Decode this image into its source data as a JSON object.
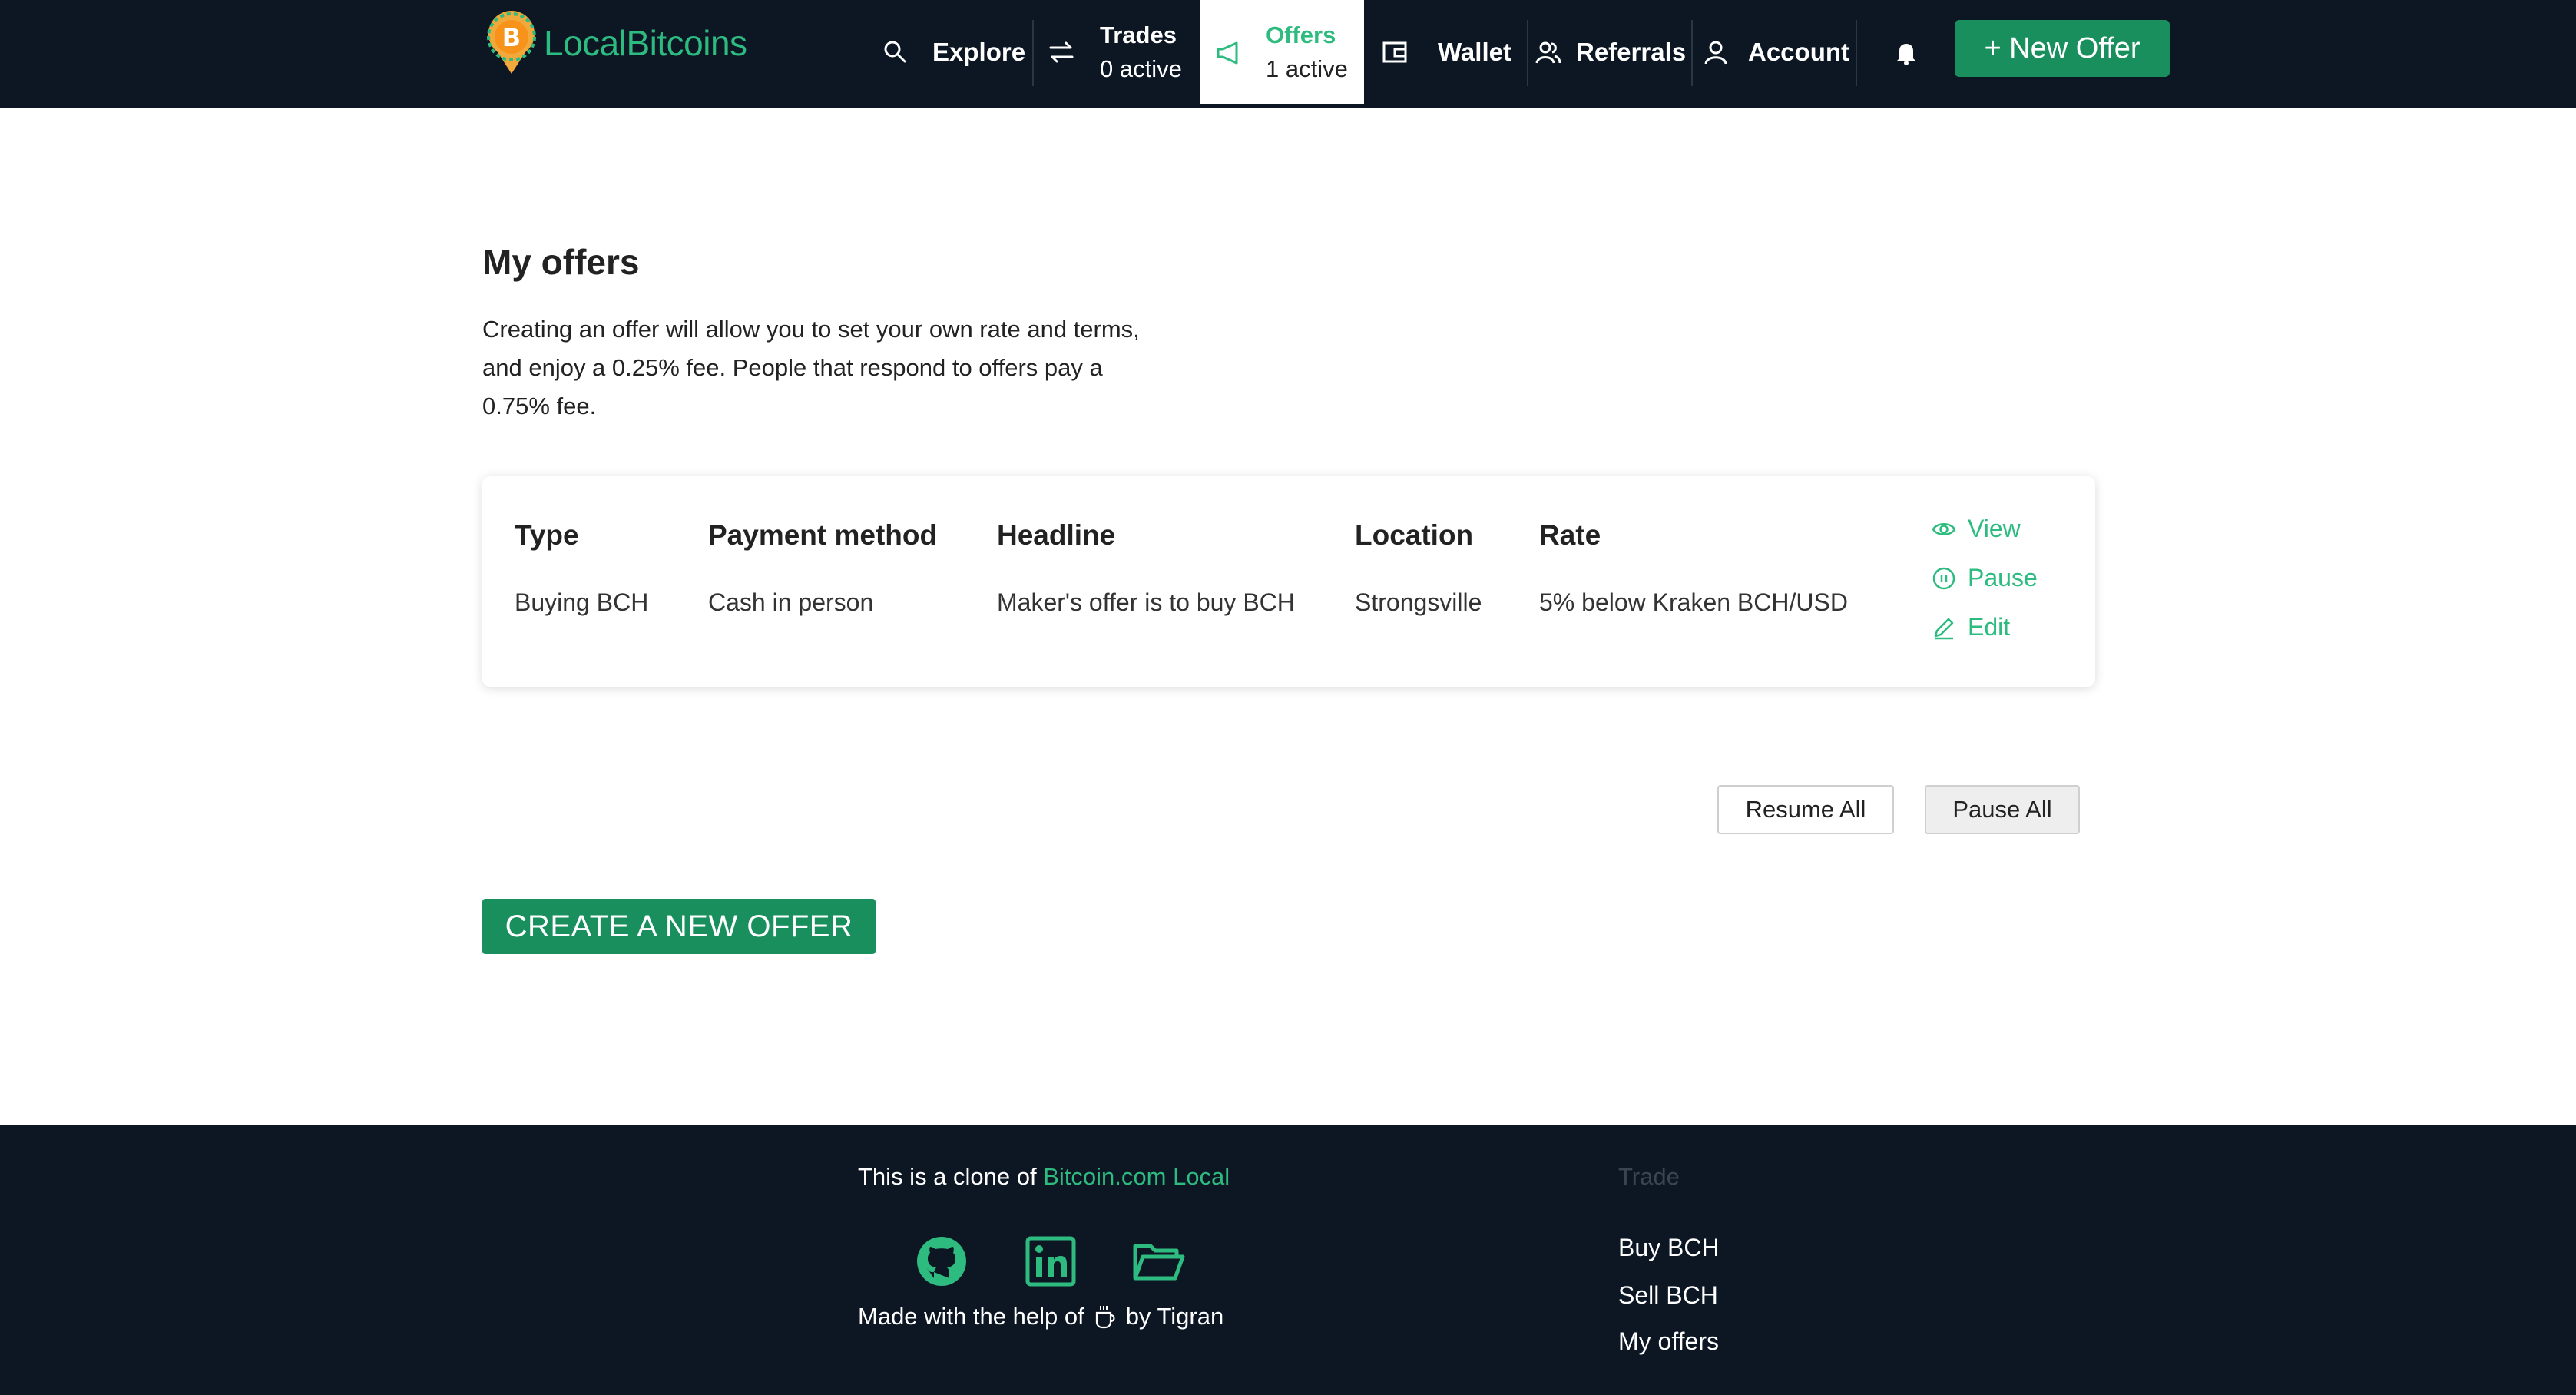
{
  "brand": {
    "name": "LocalBitcoins"
  },
  "nav": {
    "explore": {
      "label": "Explore"
    },
    "trades": {
      "label": "Trades",
      "sub": "0 active"
    },
    "offers": {
      "label": "Offers",
      "sub": "1 active"
    },
    "wallet": {
      "label": "Wallet"
    },
    "referrals": {
      "label": "Referrals"
    },
    "account": {
      "label": "Account"
    },
    "new_offer": {
      "label": "+ New Offer"
    }
  },
  "main": {
    "title": "My offers",
    "intro": "Creating an offer will allow you to set your own rate and terms, and enjoy a 0.25% fee. People that respond to offers pay a 0.75% fee.",
    "table": {
      "headers": [
        "Type",
        "Payment method",
        "Headline",
        "Location",
        "Rate"
      ],
      "rows": [
        {
          "type": "Buying BCH",
          "payment_method": "Cash in person",
          "headline": "Maker's offer is to buy BCH",
          "location": "Strongsville",
          "rate": "5% below Kraken BCH/USD"
        }
      ],
      "actions": [
        "View",
        "Pause",
        "Edit"
      ]
    },
    "resume_all": "Resume All",
    "pause_all": "Pause All",
    "create_offer": "CREATE A NEW OFFER"
  },
  "footer": {
    "clone_prefix": "This is a clone of",
    "clone_link": "Bitcoin.com Local",
    "made_prefix": "Made with the help of",
    "made_suffix": "by Tigran",
    "social_icons": [
      "github-icon",
      "linkedin-icon",
      "folder-icon"
    ],
    "trade_heading": "Trade",
    "trade_links": [
      "Buy BCH",
      "Sell BCH",
      "My offers"
    ]
  },
  "colors": {
    "header_bg": "#0d1724",
    "brand_green": "#2dbb80",
    "button_green": "#1a8f5e",
    "footer_bg": "#0d1724"
  }
}
